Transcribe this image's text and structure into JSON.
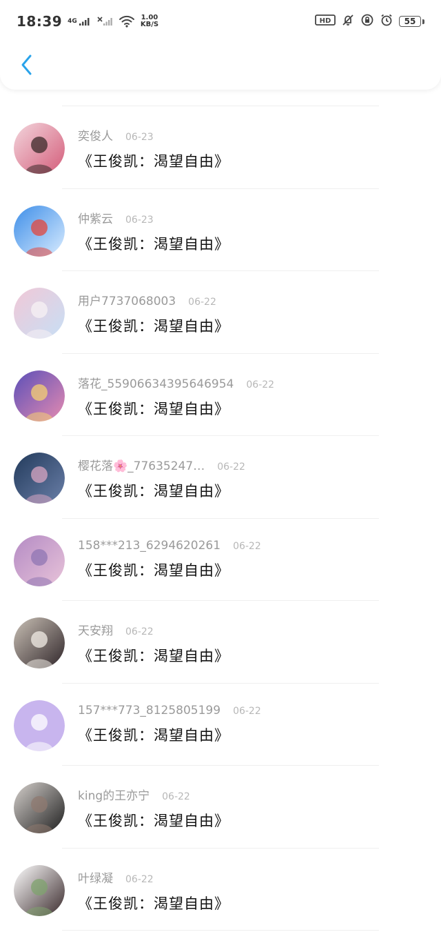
{
  "status": {
    "time": "18:39",
    "network_label": "4G",
    "net_speed_value": "1.00",
    "net_speed_unit": "KB/S",
    "battery": "55",
    "icons": [
      "signal-4g-icon",
      "no-signal-icon",
      "wifi-icon",
      "hd-icon",
      "mute-icon",
      "rotation-lock-icon",
      "alarm-icon",
      "battery-icon"
    ]
  },
  "header": {
    "back_icon": "chevron-left-icon",
    "accent": "#2aa3ea"
  },
  "messages": [
    {
      "name": "奕俊人",
      "date": "06-23",
      "text": "《王俊凯：渴望自由》",
      "avatar_colors": [
        "#f3d6dd",
        "#d45d7a",
        "#3b2a2a"
      ]
    },
    {
      "name": "仲紫云",
      "date": "06-23",
      "text": "《王俊凯：渴望自由》",
      "avatar_colors": [
        "#3e8ee8",
        "#d9ecff",
        "#e2453c"
      ]
    },
    {
      "name": "用户7737068003",
      "date": "06-22",
      "text": "《王俊凯：渴望自由》",
      "avatar_colors": [
        "#f1c8d7",
        "#c7dff5",
        "#f7f1f4"
      ]
    },
    {
      "name": "落花_5590663439564695​4",
      "date": "06-22",
      "text": "《王俊凯：渴望自由》",
      "avatar_colors": [
        "#5b4fb8",
        "#e58bb1",
        "#f5d073"
      ]
    },
    {
      "name": "樱花落🌸_77635247…",
      "date": "06-22",
      "text": "《王俊凯：渴望自由》",
      "avatar_colors": [
        "#223a5b",
        "#6a7fa8",
        "#d8a6c2"
      ]
    },
    {
      "name": "158***213_6294620261",
      "date": "06-22",
      "text": "《王俊凯：渴望自由》",
      "avatar_colors": [
        "#b48bc4",
        "#e8c3d9",
        "#8f76b3"
      ]
    },
    {
      "name": "天安翔",
      "date": "06-22",
      "text": "《王俊凯：渴望自由》",
      "avatar_colors": [
        "#c9c0b5",
        "#30262a",
        "#f1ece5"
      ]
    },
    {
      "name": "157***773_8125805199",
      "date": "06-22",
      "text": "《王俊凯：渴望自由》",
      "avatar_colors": [
        "#c8b5ee",
        "#c8b5ee",
        "#ffffff"
      ]
    },
    {
      "name": "king的王亦宁",
      "date": "06-22",
      "text": "《王俊凯：渴望自由》",
      "avatar_colors": [
        "#d5d0cc",
        "#1f1f1f",
        "#8f7a70"
      ]
    },
    {
      "name": "叶绿凝",
      "date": "06-22",
      "text": "《王俊凯：渴望自由》",
      "avatar_colors": [
        "#ffffff",
        "#3b2b2d",
        "#7fa36e"
      ]
    }
  ]
}
